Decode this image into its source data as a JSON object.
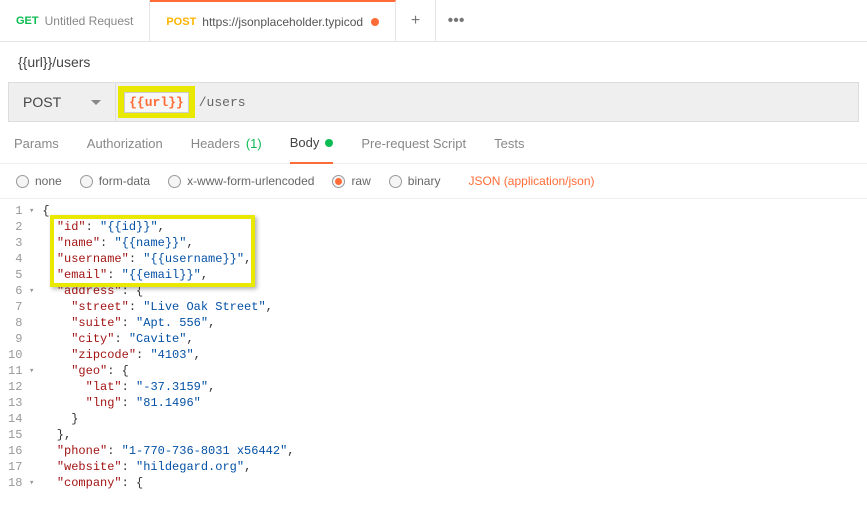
{
  "tabs": [
    {
      "method": "GET",
      "title": "Untitled Request",
      "active": false,
      "dirty": false
    },
    {
      "method": "POST",
      "title": "https://jsonplaceholder.typicod",
      "active": true,
      "dirty": true
    }
  ],
  "request_title": "{{url}}/users",
  "method": "POST",
  "url_variable": "{{url}}",
  "url_path": "/users",
  "request_tabs": {
    "params": "Params",
    "authorization": "Authorization",
    "headers_label": "Headers",
    "headers_count": "(1)",
    "body": "Body",
    "prerequest": "Pre-request Script",
    "tests": "Tests"
  },
  "body_radios": {
    "none": "none",
    "formdata": "form-data",
    "xwww": "x-www-form-urlencoded",
    "raw": "raw",
    "binary": "binary"
  },
  "content_type": "JSON (application/json)",
  "editor_lines": [
    {
      "n": 1,
      "fold": "▾",
      "tokens": [
        {
          "t": "punc",
          "v": "{"
        }
      ]
    },
    {
      "n": 2,
      "fold": "",
      "tokens": [
        {
          "t": "punc",
          "v": "  "
        },
        {
          "t": "key",
          "v": "\"id\""
        },
        {
          "t": "punc",
          "v": ": "
        },
        {
          "t": "str",
          "v": "\"{{id}}\""
        },
        {
          "t": "punc",
          "v": ","
        }
      ]
    },
    {
      "n": 3,
      "fold": "",
      "tokens": [
        {
          "t": "punc",
          "v": "  "
        },
        {
          "t": "key",
          "v": "\"name\""
        },
        {
          "t": "punc",
          "v": ": "
        },
        {
          "t": "str",
          "v": "\"{{name}}\""
        },
        {
          "t": "punc",
          "v": ","
        }
      ]
    },
    {
      "n": 4,
      "fold": "",
      "tokens": [
        {
          "t": "punc",
          "v": "  "
        },
        {
          "t": "key",
          "v": "\"username\""
        },
        {
          "t": "punc",
          "v": ": "
        },
        {
          "t": "str",
          "v": "\"{{username}}\""
        },
        {
          "t": "punc",
          "v": ","
        }
      ]
    },
    {
      "n": 5,
      "fold": "",
      "tokens": [
        {
          "t": "punc",
          "v": "  "
        },
        {
          "t": "key",
          "v": "\"email\""
        },
        {
          "t": "punc",
          "v": ": "
        },
        {
          "t": "str",
          "v": "\"{{email}}\""
        },
        {
          "t": "punc",
          "v": ","
        }
      ]
    },
    {
      "n": 6,
      "fold": "▾",
      "tokens": [
        {
          "t": "punc",
          "v": "  "
        },
        {
          "t": "key",
          "v": "\"address\""
        },
        {
          "t": "punc",
          "v": ": {"
        }
      ]
    },
    {
      "n": 7,
      "fold": "",
      "tokens": [
        {
          "t": "punc",
          "v": "    "
        },
        {
          "t": "key",
          "v": "\"street\""
        },
        {
          "t": "punc",
          "v": ": "
        },
        {
          "t": "str",
          "v": "\"Live Oak Street\""
        },
        {
          "t": "punc",
          "v": ","
        }
      ]
    },
    {
      "n": 8,
      "fold": "",
      "tokens": [
        {
          "t": "punc",
          "v": "    "
        },
        {
          "t": "key",
          "v": "\"suite\""
        },
        {
          "t": "punc",
          "v": ": "
        },
        {
          "t": "str",
          "v": "\"Apt. 556\""
        },
        {
          "t": "punc",
          "v": ","
        }
      ]
    },
    {
      "n": 9,
      "fold": "",
      "tokens": [
        {
          "t": "punc",
          "v": "    "
        },
        {
          "t": "key",
          "v": "\"city\""
        },
        {
          "t": "punc",
          "v": ": "
        },
        {
          "t": "str",
          "v": "\"Cavite\""
        },
        {
          "t": "punc",
          "v": ","
        }
      ]
    },
    {
      "n": 10,
      "fold": "",
      "tokens": [
        {
          "t": "punc",
          "v": "    "
        },
        {
          "t": "key",
          "v": "\"zipcode\""
        },
        {
          "t": "punc",
          "v": ": "
        },
        {
          "t": "str",
          "v": "\"4103\""
        },
        {
          "t": "punc",
          "v": ","
        }
      ]
    },
    {
      "n": 11,
      "fold": "▾",
      "tokens": [
        {
          "t": "punc",
          "v": "    "
        },
        {
          "t": "key",
          "v": "\"geo\""
        },
        {
          "t": "punc",
          "v": ": {"
        }
      ]
    },
    {
      "n": 12,
      "fold": "",
      "tokens": [
        {
          "t": "punc",
          "v": "      "
        },
        {
          "t": "key",
          "v": "\"lat\""
        },
        {
          "t": "punc",
          "v": ": "
        },
        {
          "t": "str",
          "v": "\"-37.3159\""
        },
        {
          "t": "punc",
          "v": ","
        }
      ]
    },
    {
      "n": 13,
      "fold": "",
      "tokens": [
        {
          "t": "punc",
          "v": "      "
        },
        {
          "t": "key",
          "v": "\"lng\""
        },
        {
          "t": "punc",
          "v": ": "
        },
        {
          "t": "str",
          "v": "\"81.1496\""
        }
      ]
    },
    {
      "n": 14,
      "fold": "",
      "tokens": [
        {
          "t": "punc",
          "v": "    }"
        }
      ]
    },
    {
      "n": 15,
      "fold": "",
      "tokens": [
        {
          "t": "punc",
          "v": "  },"
        }
      ]
    },
    {
      "n": 16,
      "fold": "",
      "tokens": [
        {
          "t": "punc",
          "v": "  "
        },
        {
          "t": "key",
          "v": "\"phone\""
        },
        {
          "t": "punc",
          "v": ": "
        },
        {
          "t": "str",
          "v": "\"1-770-736-8031 x56442\""
        },
        {
          "t": "punc",
          "v": ","
        }
      ]
    },
    {
      "n": 17,
      "fold": "",
      "tokens": [
        {
          "t": "punc",
          "v": "  "
        },
        {
          "t": "key",
          "v": "\"website\""
        },
        {
          "t": "punc",
          "v": ": "
        },
        {
          "t": "str",
          "v": "\"hildegard.org\""
        },
        {
          "t": "punc",
          "v": ","
        }
      ]
    },
    {
      "n": 18,
      "fold": "▾",
      "tokens": [
        {
          "t": "punc",
          "v": "  "
        },
        {
          "t": "key",
          "v": "\"company\""
        },
        {
          "t": "punc",
          "v": ": {"
        }
      ]
    }
  ]
}
